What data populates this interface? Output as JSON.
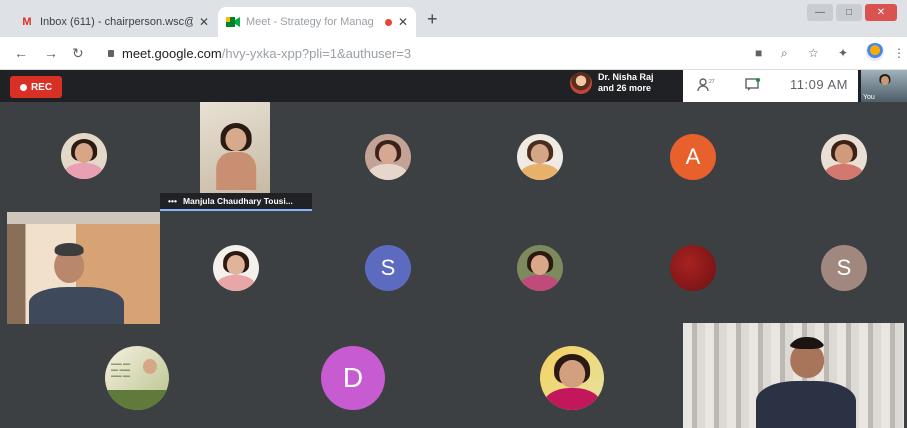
{
  "browser": {
    "tabs": [
      {
        "title": "Inbox (611) - chairperson.wsc@·",
        "icon": "gmail-icon",
        "active": false
      },
      {
        "title": "Meet - Strategy for Manag",
        "icon": "meet-icon",
        "active": true
      }
    ],
    "new_tab": "+",
    "window_controls": {
      "minimize": "—",
      "maximize": "□",
      "close": "✕"
    },
    "address": {
      "url_main": "meet.google.com",
      "url_rest": "/hvy-yxka-xpp?pli=1&authuser=3"
    }
  },
  "meet": {
    "rec_label": "REC",
    "presenter": {
      "line1": "Dr. Nisha Raj",
      "line2": "and 26 more"
    },
    "time": "11:09 AM",
    "self_view_label": "You",
    "pinned_name": "Manjula Chaudhary Tousi...",
    "participants": [
      {
        "type": "photo",
        "initial": ""
      },
      {
        "type": "video",
        "initial": ""
      },
      {
        "type": "photo",
        "initial": ""
      },
      {
        "type": "photo",
        "initial": ""
      },
      {
        "type": "initial",
        "initial": "A",
        "color": "#e8612c"
      },
      {
        "type": "photo",
        "initial": ""
      },
      {
        "type": "video",
        "initial": ""
      },
      {
        "type": "photo",
        "initial": ""
      },
      {
        "type": "initial",
        "initial": "S",
        "color": "#5c6bc0"
      },
      {
        "type": "photo",
        "initial": ""
      },
      {
        "type": "blank",
        "initial": "",
        "color": "#8b1a1a"
      },
      {
        "type": "initial",
        "initial": "S",
        "color": "#a1887f"
      },
      {
        "type": "photo",
        "initial": ""
      },
      {
        "type": "initial",
        "initial": "D",
        "color": "#c75bd1"
      },
      {
        "type": "photo",
        "initial": ""
      },
      {
        "type": "video",
        "initial": ""
      }
    ]
  },
  "colors": {
    "rec": "#d93025",
    "meet_bg": "#3c4043",
    "avatar_a": "#e8612c",
    "avatar_s1": "#5c6bc0",
    "avatar_s2": "#a1887f",
    "avatar_d": "#c75bd1"
  }
}
